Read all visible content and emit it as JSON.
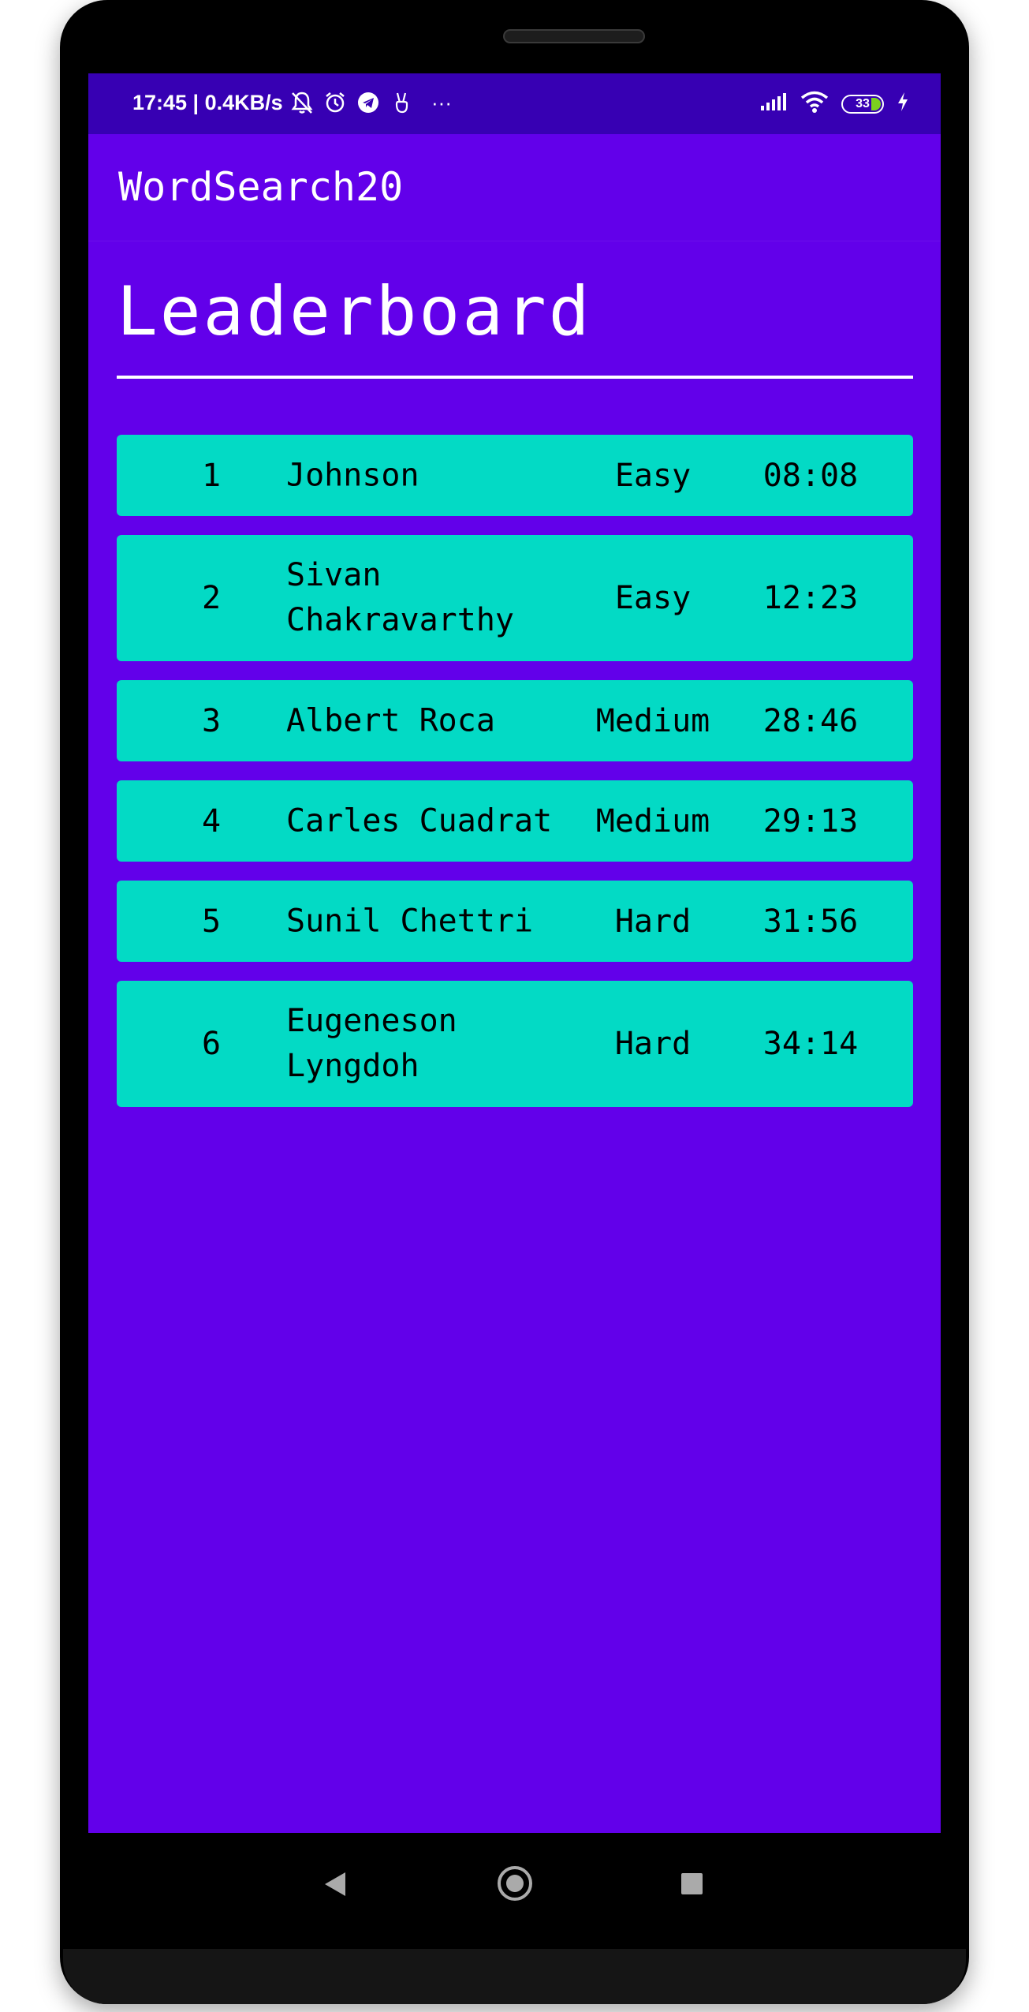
{
  "statusbar": {
    "time_speed": "17:45 | 0.4KB/s",
    "more": "···",
    "battery_level": "33",
    "icons": [
      "mute-bell-icon",
      "alarm-icon",
      "telegram-icon",
      "victory-hand-icon",
      "signal-icon",
      "wifi-icon",
      "battery-icon",
      "charging-icon"
    ]
  },
  "app": {
    "title": "WordSearch20"
  },
  "page": {
    "heading": "Leaderboard"
  },
  "leaderboard": [
    {
      "rank": "1",
      "name": "Johnson",
      "level": "Easy",
      "time": "08:08"
    },
    {
      "rank": "2",
      "name": "Sivan Chakravarthy",
      "level": "Easy",
      "time": "12:23"
    },
    {
      "rank": "3",
      "name": "Albert Roca",
      "level": "Medium",
      "time": "28:46"
    },
    {
      "rank": "4",
      "name": "Carles Cuadrat",
      "level": "Medium",
      "time": "29:13"
    },
    {
      "rank": "5",
      "name": "Sunil Chettri",
      "level": "Hard",
      "time": "31:56"
    },
    {
      "rank": "6",
      "name": "Eugeneson Lyngdoh",
      "level": "Hard",
      "time": "34:14"
    }
  ],
  "colors": {
    "primary": "#6200ea",
    "primary_dark": "#3700b3",
    "row_accent": "#03dac5"
  },
  "navbar": {
    "icons": [
      "back-icon",
      "home-icon",
      "recents-icon"
    ]
  }
}
